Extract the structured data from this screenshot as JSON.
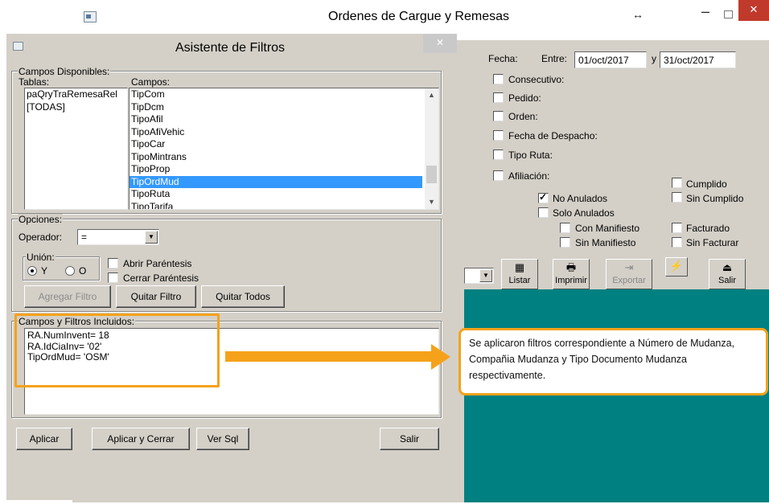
{
  "main_window": {
    "title": "Ordenes de Cargue y Remesas",
    "resize_glyph": "↔",
    "minimize_glyph": "–",
    "close_glyph": "✕"
  },
  "filter_panel": {
    "fecha_label": "Fecha:",
    "entre_label": "Entre:",
    "fecha_desde": "01/oct/2017",
    "y_label": "y",
    "fecha_hasta": "31/oct/2017",
    "checks": [
      {
        "label": "Consecutivo:",
        "checked": false
      },
      {
        "label": "Pedido:",
        "checked": false
      },
      {
        "label": "Orden:",
        "checked": false
      },
      {
        "label": "Fecha de Despacho:",
        "checked": false
      },
      {
        "label": "Tipo Ruta:",
        "checked": false
      },
      {
        "label": "Afiliación:",
        "checked": false
      }
    ],
    "estado_checks": [
      {
        "label": "No Anulados",
        "checked": true
      },
      {
        "label": "Solo Anulados",
        "checked": false
      },
      {
        "label": "Con Manifiesto",
        "checked": false
      },
      {
        "label": "Sin Manifiesto",
        "checked": false
      },
      {
        "label": "Cumplido",
        "checked": false
      },
      {
        "label": "Sin Cumplido",
        "checked": false
      },
      {
        "label": "Facturado",
        "checked": false
      },
      {
        "label": "Sin Facturar",
        "checked": false
      }
    ],
    "toolbar": {
      "listar": "Listar",
      "imprimir": "Imprimir",
      "exportar": "Exportar",
      "salir": "Salir"
    }
  },
  "dialog": {
    "title": "Asistente de Filtros",
    "close_glyph": "✕",
    "campos_disponibles_label": "Campos Disponibles:",
    "tablas_label": "Tablas:",
    "campos_label": "Campos:",
    "tablas": [
      "paQryTraRemesaRel",
      "[TODAS]"
    ],
    "campos": [
      "TipCom",
      "TipDcm",
      "TipoAfil",
      "TipoAfiVehic",
      "TipoCar",
      "TipoMintrans",
      "TipoProp",
      "TipOrdMud",
      "TipoRuta",
      "TipoTarifa"
    ],
    "campos_selected_index": 7,
    "opciones_label": "Opciones:",
    "operador_label": "Operador:",
    "operador_value": "=",
    "union_label": "Unión:",
    "union_y": "Y",
    "union_o": "O",
    "abrir_parentesis": "Abrir Paréntesis",
    "cerrar_parentesis": "Cerrar Paréntesis",
    "agregar_filtro": "Agregar Filtro",
    "quitar_filtro": "Quitar Filtro",
    "quitar_todos": "Quitar Todos",
    "incluidos_label": "Campos y Filtros Incluidos:",
    "filtros": [
      "RA.NumInvent= 18",
      "RA.IdCiaInv= '02'",
      "TipOrdMud= 'OSM'"
    ],
    "aplicar": "Aplicar",
    "aplicar_cerrar": "Aplicar y Cerrar",
    "ver_sql": "Ver Sql",
    "salir": "Salir"
  },
  "callout": {
    "text": "Se aplicaron filtros correspondiente a Número de Mudanza, Compañia Mudanza y Tipo Documento Mudanza respectivamente."
  },
  "colors": {
    "dialog_bg": "#d4d0c8",
    "teal": "#008080",
    "selection": "#3399ff",
    "annotation": "#f5a21a"
  }
}
